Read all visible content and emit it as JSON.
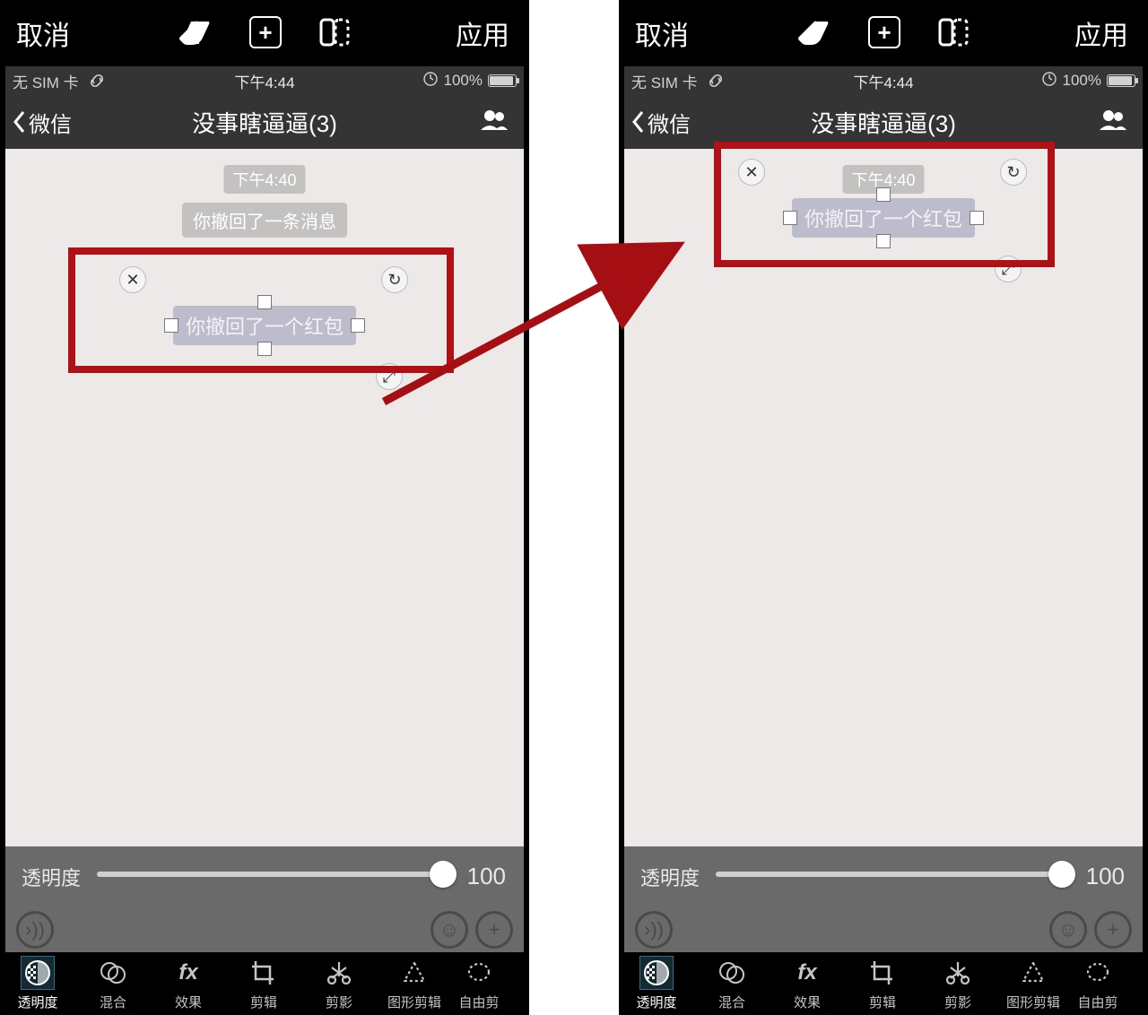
{
  "editor": {
    "cancel": "取消",
    "apply": "应用",
    "opacity_label": "透明度",
    "opacity_value": "100",
    "tools": {
      "opacity": "透明度",
      "blend": "混合",
      "fx": "效果",
      "crop": "剪辑",
      "shadow": "剪影",
      "shape_crop": "图形剪辑",
      "free_crop": "自由剪辑",
      "free_crop_trunc": "自由剪"
    }
  },
  "status": {
    "carrier": "无 SIM 卡",
    "time": "下午4:44",
    "battery": "100%"
  },
  "nav": {
    "back": "微信",
    "title": "没事瞎逼逼(3)"
  },
  "chat": {
    "time_pill": "下午4:40",
    "recall_msg": "你撤回了一条消息",
    "recall_hongbao": "你撤回了一个红包"
  }
}
